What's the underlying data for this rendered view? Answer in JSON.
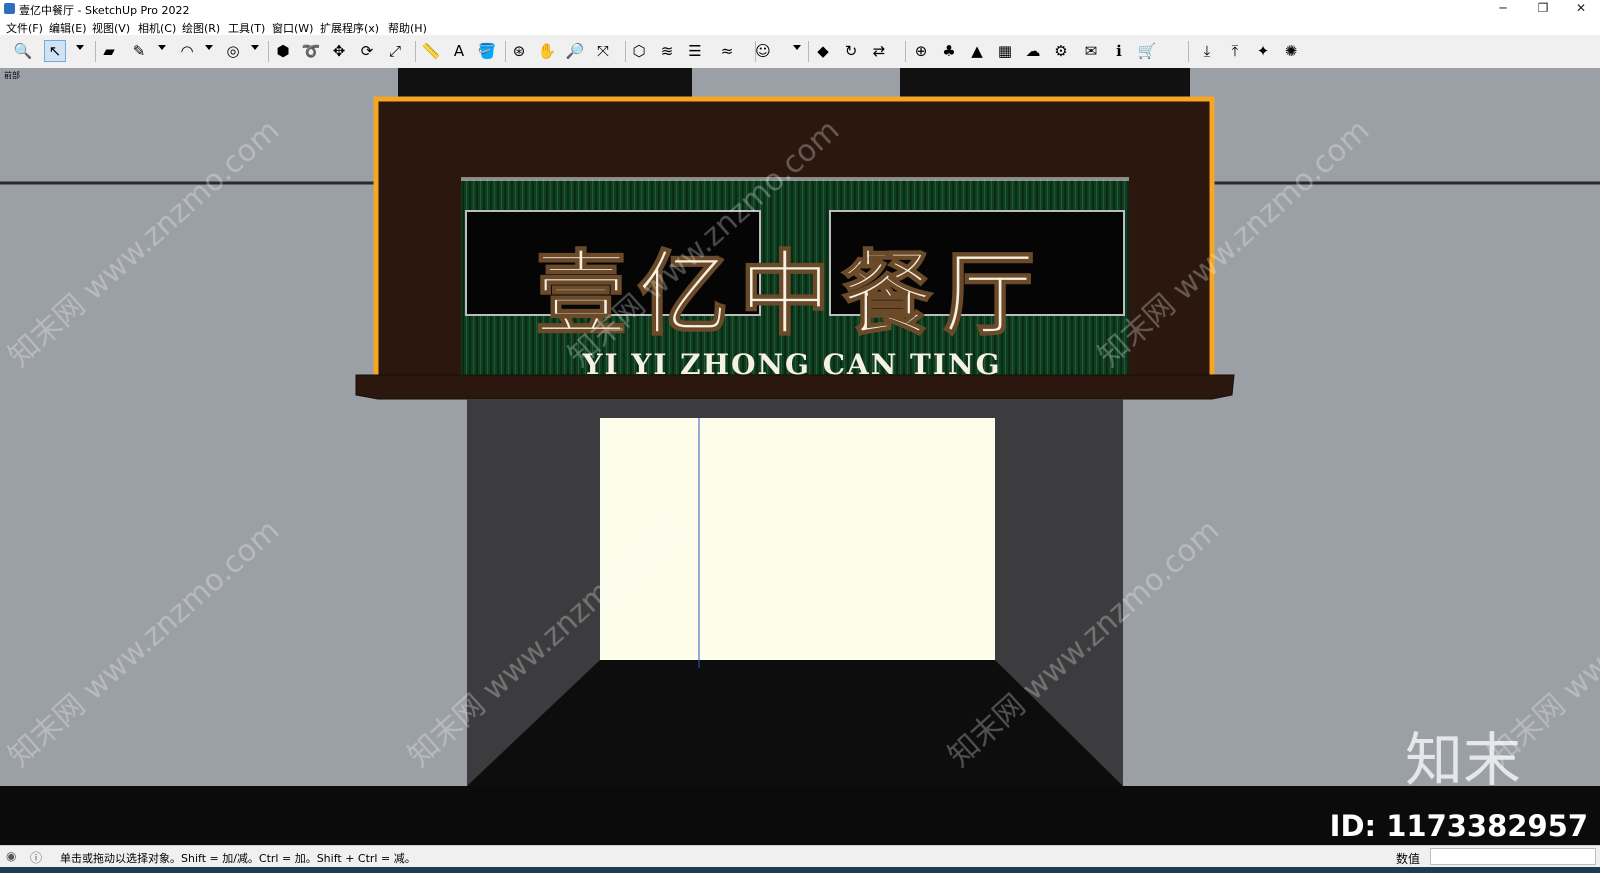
{
  "window": {
    "title": "壹亿中餐厅 - SketchUp Pro 2022",
    "controls": {
      "minimize": "─",
      "restore": "❐",
      "close": "✕"
    }
  },
  "menu": [
    "文件(F)",
    "编辑(E)",
    "视图(V)",
    "相机(C)",
    "绘图(R)",
    "工具(T)",
    "窗口(W)",
    "扩展程序(x)",
    "帮助(H)"
  ],
  "toolbar": {
    "tools": [
      {
        "icon": "zoom-icon",
        "glyph": "🔍"
      },
      {
        "icon": "select-arrow-icon",
        "glyph": "↖",
        "active": true
      },
      {
        "icon": "eraser-icon",
        "glyph": "▰"
      },
      {
        "icon": "pencil-icon",
        "glyph": "✎"
      },
      {
        "icon": "arc-icon",
        "glyph": "◠"
      },
      {
        "icon": "circle-shape-icon",
        "glyph": "◎"
      },
      {
        "icon": "push-pull-icon",
        "glyph": "⬢"
      },
      {
        "icon": "follow-me-icon",
        "glyph": "➰"
      },
      {
        "icon": "move-icon",
        "glyph": "✥"
      },
      {
        "icon": "rotate-icon",
        "glyph": "⟳"
      },
      {
        "icon": "scale-icon",
        "glyph": "⤢"
      },
      {
        "icon": "tape-measure-icon",
        "glyph": "📏"
      },
      {
        "icon": "text-icon",
        "glyph": "A"
      },
      {
        "icon": "paint-bucket-icon",
        "glyph": "🪣"
      },
      {
        "icon": "orbit-icon",
        "glyph": "⊛"
      },
      {
        "icon": "pan-icon",
        "glyph": "✋"
      },
      {
        "icon": "zoom-view-icon",
        "glyph": "🔎"
      },
      {
        "icon": "zoom-extents-icon",
        "glyph": "⤧"
      },
      {
        "icon": "components-icon",
        "glyph": "⬡"
      },
      {
        "icon": "sandbox-icon",
        "glyph": "≋"
      },
      {
        "icon": "layers-icon",
        "glyph": "☰"
      },
      {
        "icon": "styles-icon",
        "glyph": "≈"
      },
      {
        "icon": "account-icon",
        "glyph": "☺"
      },
      {
        "icon": "extension-warehouse-icon",
        "glyph": "◆"
      },
      {
        "icon": "refresh-icon",
        "glyph": "↻"
      },
      {
        "icon": "transfer-icon",
        "glyph": "⇄"
      },
      {
        "icon": "add-location-icon",
        "glyph": "⊕"
      },
      {
        "icon": "tree-icon",
        "glyph": "♣"
      },
      {
        "icon": "terrain-icon",
        "glyph": "▲"
      },
      {
        "icon": "checker-icon",
        "glyph": "▦"
      },
      {
        "icon": "cloud-upload-icon",
        "glyph": "☁"
      },
      {
        "icon": "gears-icon",
        "glyph": "⚙"
      },
      {
        "icon": "mail-icon",
        "glyph": "✉"
      },
      {
        "icon": "info-icon",
        "glyph": "ℹ"
      },
      {
        "icon": "cart-icon",
        "glyph": "🛒"
      },
      {
        "icon": "import-icon",
        "glyph": "⤓"
      },
      {
        "icon": "export-icon",
        "glyph": "⤒"
      },
      {
        "icon": "render-icon",
        "glyph": "✦"
      },
      {
        "icon": "settings-icon",
        "glyph": "✺"
      }
    ]
  },
  "viewport": {
    "scene_label": "前部",
    "sign": {
      "title": "壹亿中餐厅",
      "subtitle": "YI YI ZHONG CAN TING"
    },
    "watermark": {
      "text": "知末网 www.znzmo.com",
      "logo": "知末",
      "id": "ID: 1173382957"
    },
    "colors": {
      "wall": "#9b9fa6",
      "sign_brown": "#2b170d",
      "sign_border": "#f5a623",
      "green_panel": "#0f3d20",
      "door_light": "#fdfdec"
    }
  },
  "status": {
    "hint": "单击或拖动以选择对象。Shift = 加/减。Ctrl = 加。Shift + Ctrl = 减。",
    "measurements_label": "数值",
    "measurements_value": ""
  }
}
